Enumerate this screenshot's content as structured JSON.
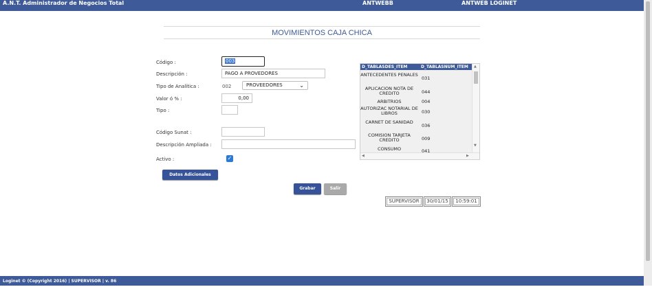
{
  "app": {
    "title": "A.N.T. Administrador de Negocios Total",
    "server": "ANTWEBB",
    "login": "ANTWEB LOGINET"
  },
  "page": {
    "title": "MOVIMIENTOS CAJA CHICA"
  },
  "form": {
    "codigo_label": "Código :",
    "codigo_value": "003",
    "descripcion_label": "Descripción :",
    "descripcion_value": "PAGO A PROVEDORES",
    "analitica_label": "Tipo de Analítica :",
    "analitica_code": "002",
    "analitica_selected": "PROVEEDORES",
    "valor_label": "Valor ó % :",
    "valor_value": "0,00",
    "tipo_label": "Tipo :",
    "tipo_value": "",
    "sunat_label": "Código Sunat :",
    "sunat_value": "",
    "ampliada_label": "Descripción Ampliada :",
    "ampliada_value": "",
    "activo_label": "Activo :",
    "activo_checked": true
  },
  "buttons": {
    "datos_adicionales": "Datos Adicionales",
    "grabar": "Grabar",
    "salir": "Salir"
  },
  "grid": {
    "columns": [
      "D_TABLASDES_ITEM",
      "D_TABLASNUM_ITEM"
    ],
    "rows": [
      {
        "desc": "ANTECEDENTES PENALES",
        "num": "031"
      },
      {
        "desc": "APLICACION NOTA DE CREDITO",
        "num": "044"
      },
      {
        "desc": "ARBITRIOS",
        "num": "004"
      },
      {
        "desc": "AUTORIZAC NOTARIAL DE LIBROS",
        "num": "030"
      },
      {
        "desc": "CARNET DE SANIDAD",
        "num": "036"
      },
      {
        "desc": "COMISION TARJETA CREDITO",
        "num": "009"
      },
      {
        "desc": "CONSUMO",
        "num": "041"
      }
    ]
  },
  "status": {
    "user": "SUPERVISOR",
    "date": "30/01/15",
    "time": "10:59:01"
  },
  "footer": {
    "text": "Loginet © (Copyright 2016) | SUPERVISOR | v. 86"
  },
  "colors": {
    "brand": "#3e5a98",
    "button": "#36539a",
    "disabled": "#a9a9a9",
    "check": "#2b7bd6"
  }
}
